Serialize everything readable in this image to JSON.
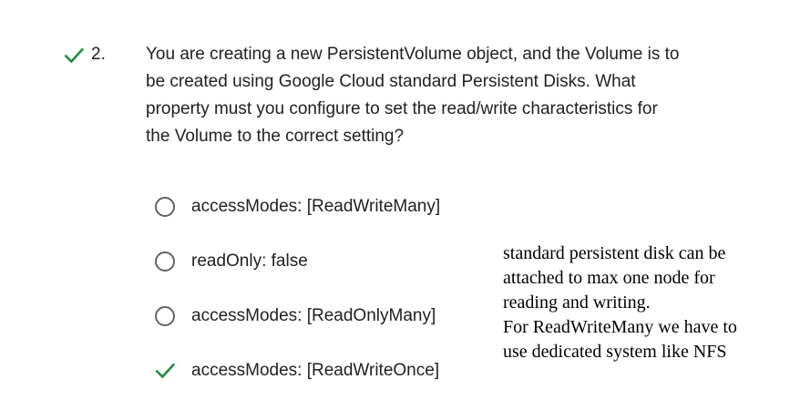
{
  "question": {
    "status_icon": "check-icon",
    "status_color": "#1e8e3e",
    "number": "2.",
    "text_lines": [
      "You are creating a new PersistentVolume object, and the Volume is to",
      "be created using Google Cloud standard Persistent Disks. What",
      "property must you configure to set the read/write characteristics for",
      "the Volume to the correct setting?"
    ]
  },
  "options": [
    {
      "label": "accessModes: [ReadWriteMany]",
      "selected": false,
      "correct": false,
      "icon": "radio-unselected-icon"
    },
    {
      "label": "readOnly: false",
      "selected": false,
      "correct": false,
      "icon": "radio-unselected-icon"
    },
    {
      "label": "accessModes: [ReadOnlyMany]",
      "selected": false,
      "correct": false,
      "icon": "radio-unselected-icon"
    },
    {
      "label": "accessModes: [ReadWriteOnce]",
      "selected": true,
      "correct": true,
      "icon": "check-icon"
    }
  ],
  "note": {
    "lines": [
      "standard persistent disk can be",
      "attached to max one node for",
      "reading and writing.",
      "For ReadWriteMany we have to",
      "use dedicated system like NFS"
    ]
  },
  "colors": {
    "correct": "#1e8e3e",
    "radio_border": "#5f6368",
    "text": "#202124"
  }
}
